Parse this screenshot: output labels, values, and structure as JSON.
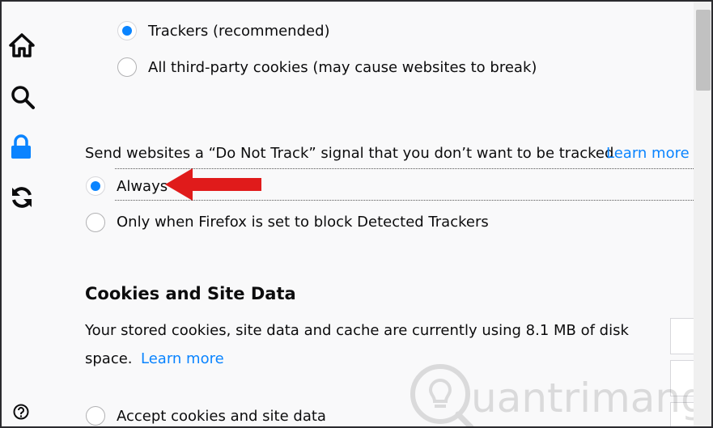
{
  "sidebar": {
    "icons": [
      "home-icon",
      "search-icon",
      "lock-icon",
      "sync-icon",
      "help-icon"
    ]
  },
  "trackers": {
    "option_trackers": "Trackers (recommended)",
    "option_third_party": "All third-party cookies (may cause websites to break)"
  },
  "dnt": {
    "description": "Send websites a “Do Not Track” signal that you don’t want to be tracked",
    "learn_more": "Learn more",
    "option_always": "Always",
    "option_only_when": "Only when Firefox is set to block Detected Trackers"
  },
  "cookies_section": {
    "heading": "Cookies and Site Data",
    "usage_line1": "Your stored cookies, site data and cache are currently using 8.1 MB of disk",
    "usage_line2": "space.",
    "learn_more": "Learn more",
    "option_accept": "Accept cookies and site data"
  },
  "watermark": {
    "text": "uantrimang"
  },
  "colors": {
    "accent": "#0a84ff",
    "arrow": "#e01b1b"
  }
}
